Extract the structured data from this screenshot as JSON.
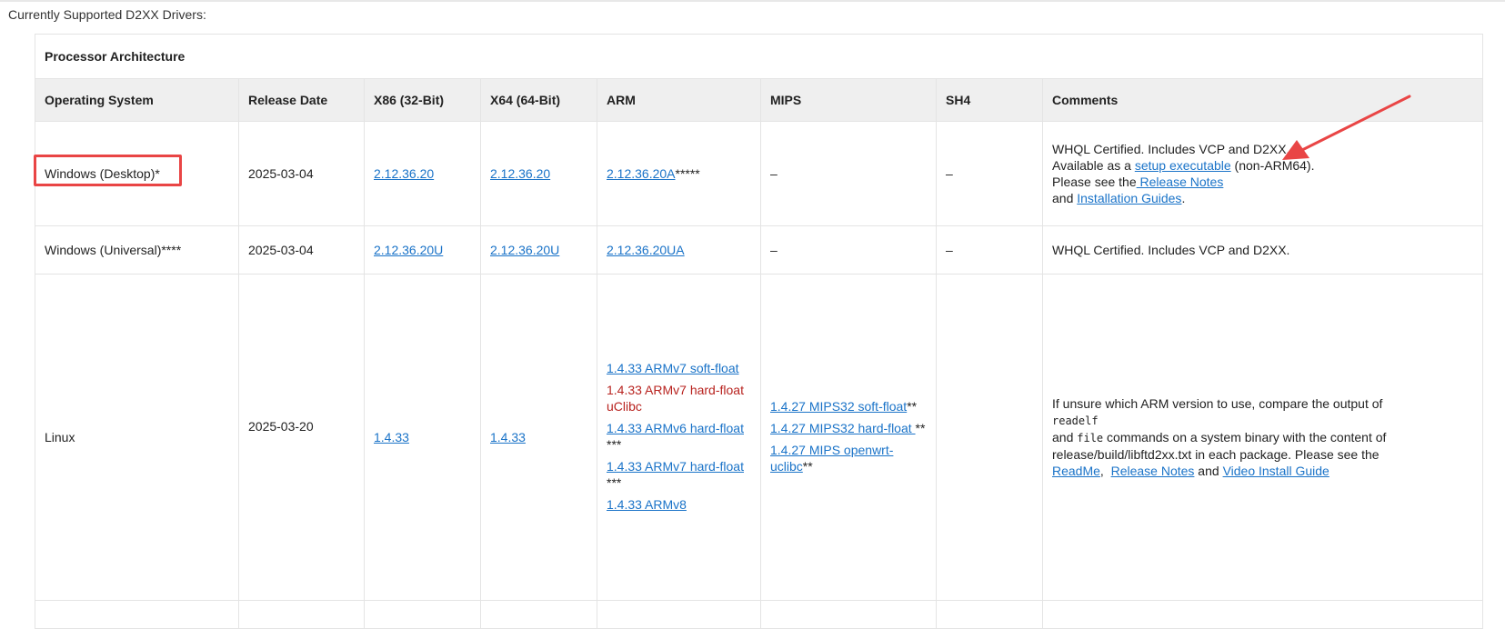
{
  "caption": "Currently Supported D2XX Drivers:",
  "table": {
    "arch_header": "Processor Architecture",
    "columns": [
      "Operating System",
      "Release Date",
      "X86 (32-Bit)",
      "X64 (64-Bit)",
      "ARM",
      "MIPS",
      "SH4",
      "Comments"
    ],
    "rows": {
      "desktop": {
        "os": "Windows (Desktop)*",
        "date": "2025-03-04",
        "x86": "2.12.36.20",
        "x64": "2.12.36.20",
        "arm": "2.12.36.20A",
        "arm_suffix": "*****",
        "mips": "–",
        "sh4": "–",
        "comment_line1": "WHQL Certified. Includes VCP and D2XX.",
        "comment_avail_pre": "Available as a ",
        "comment_avail_link": "setup executable",
        "comment_avail_post": " (non-ARM64).",
        "comment_see_pre": "Please see the",
        "comment_release_notes": " Release Notes",
        "comment_and": "and ",
        "comment_install_guides": "Installation Guides",
        "comment_end": "."
      },
      "universal": {
        "os": "Windows (Universal)****",
        "date": "2025-03-04",
        "x86": "2.12.36.20U",
        "x64": "2.12.36.20U",
        "arm": "2.12.36.20UA",
        "mips": "–",
        "sh4": "–",
        "comment": "WHQL Certified. Includes VCP and D2XX."
      },
      "linux": {
        "os": "Linux",
        "date": "2025-03-20",
        "x86": "1.4.33",
        "x64": "1.4.33",
        "arm_1": "1.4.33 ARMv7 soft-float",
        "arm_2": "1.4.33 ARMv7 hard-float uClibc",
        "arm_3": "1.4.33 ARMv6 hard-float",
        "arm_3_suffix": "***",
        "arm_4": "1.4.33 ARMv7 hard-float",
        "arm_4_suffix": "***",
        "arm_5": "1.4.33 ARMv8",
        "mips_1": "1.4.27 MIPS32 soft-float",
        "mips_1_suffix": "**",
        "mips_2": "1.4.27 MIPS32 hard-float ",
        "mips_2_suffix": "**",
        "mips_3": "1.4.27 MIPS openwrt-uclibc",
        "mips_3_suffix": "**",
        "sh4": "",
        "comment_1": "If unsure which ARM version to use, compare the output of",
        "comment_readelf": "readelf",
        "comment_and": "and ",
        "comment_file": "file",
        "comment_2": " commands on a system binary with the content of release/build/libftd2xx.txt in each package. Please see the",
        "comment_readme": "ReadMe",
        "comment_sep": ",  ",
        "comment_release_notes": "Release Notes",
        "comment_and2": " and ",
        "comment_video": "Video Install Guide"
      }
    }
  },
  "annotations": {
    "highlight_color": "#e94545",
    "arrow_color": "#e94545"
  }
}
